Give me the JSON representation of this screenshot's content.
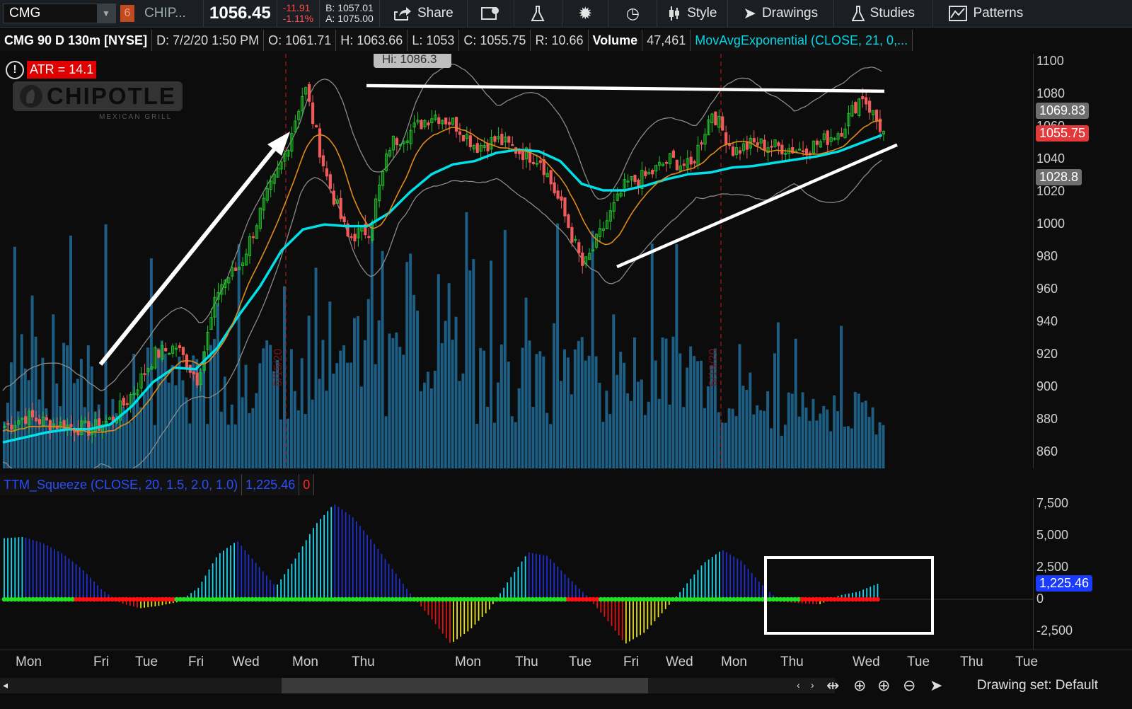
{
  "toolbar": {
    "symbol": "CMG",
    "link_badge": "6",
    "company": "CHIP...",
    "last": "1056.45",
    "net_change": "-11.91",
    "pct_change": "-1.11%",
    "bid": "B: 1057.01",
    "ask": "A: 1075.00",
    "share_label": "Share",
    "style_label": "Style",
    "drawings_label": "Drawings",
    "studies_label": "Studies",
    "patterns_label": "Patterns"
  },
  "infobar": {
    "title": "CMG 90 D 130m [NYSE]",
    "date": "D: 7/2/20 1:50 PM",
    "open": "O: 1061.71",
    "high": "H: 1063.66",
    "low": "L: 1053",
    "close": "C: 1055.75",
    "range": "R: 10.66",
    "volume_label": "Volume",
    "volume_value": "47,461",
    "study": "MovAvgExponential (CLOSE, 21, 0,..."
  },
  "atr_label": "ATR = 14.1",
  "logo": {
    "text": "CHIPOTLE",
    "sub": "MEXICAN GRILL"
  },
  "hi_label": "Hi: 1086.3",
  "price_axis": [
    "1100",
    "1080",
    "1060",
    "1040",
    "1020",
    "1000",
    "980",
    "960",
    "940",
    "920",
    "900",
    "880",
    "860"
  ],
  "price_tags": {
    "upper_band": "1069.83",
    "last": "1055.75",
    "ema": "1028.8"
  },
  "indicator": {
    "title": "TTM_Squeeze (CLOSE, 20, 1.5, 2.0, 1.0)",
    "value": "1,225.46",
    "signal": "0",
    "axis": [
      "7,500",
      "5,000",
      "2,500",
      "0",
      "-2,500"
    ],
    "tag": "1,225.46"
  },
  "x_axis": [
    "Mon",
    "Fri",
    "Tue",
    "Fri",
    "Wed",
    "Mon",
    "Thu",
    "Mon",
    "Thu",
    "Tue",
    "Fri",
    "Wed",
    "Mon",
    "Thu",
    "Wed",
    "Tue",
    "Thu",
    "Tue"
  ],
  "divider_dates": [
    "5/15/20",
    "6/19/20"
  ],
  "bottom": {
    "drawing_set": "Drawing set: Default"
  },
  "colors": {
    "up": "#22c02a",
    "down": "#f05a5a",
    "ema_fast": "#00e0e8",
    "ema_slow": "#e08a1a",
    "volume": "#1d5f84",
    "squeeze_on": "#ff1010",
    "squeeze_off": "#22e022"
  },
  "chart_data": [
    {
      "type": "line",
      "title": "CMG 90 D 130m [NYSE]",
      "xlabel": "",
      "ylabel": "",
      "ylim": [
        850,
        1105
      ],
      "grid": false,
      "series": [
        {
          "name": "MovAvgExponential",
          "values": [
            866,
            869,
            872,
            874,
            874,
            877,
            888,
            903,
            912,
            911,
            924,
            944,
            962,
            984,
            997,
            1000,
            999,
            999,
            1007,
            1020,
            1031,
            1037,
            1039,
            1044,
            1046,
            1045,
            1039,
            1025,
            1021,
            1021,
            1024,
            1028,
            1031,
            1032,
            1035,
            1036,
            1038,
            1040,
            1042,
            1045,
            1050,
            1055
          ]
        }
      ],
      "close_path": [
        876,
        882,
        878,
        876,
        874,
        880,
        897,
        920,
        925,
        905,
        962,
        975,
        1010,
        1040,
        1085,
        1030,
        992,
        997,
        1050,
        1058,
        1068,
        1062,
        1048,
        1052,
        1045,
        1040,
        1010,
        973,
        1000,
        1025,
        1030,
        1040,
        1035,
        1070,
        1045,
        1050,
        1048,
        1046,
        1050,
        1058,
        1080,
        1056
      ]
    },
    {
      "type": "bar",
      "title": "TTM_Squeeze (CLOSE, 20, 1.5, 2.0, 1.0)",
      "ylim": [
        -3500,
        7500
      ],
      "values": [
        4800,
        4900,
        4400,
        3600,
        2400,
        800,
        -300,
        -700,
        -500,
        -200,
        900,
        3500,
        4600,
        2800,
        1000,
        3200,
        5800,
        7500,
        6400,
        4500,
        2400,
        300,
        -1500,
        -3500,
        -2400,
        -800,
        1500,
        3700,
        3400,
        1800,
        300,
        -1500,
        -3500,
        -2600,
        -900,
        900,
        2800,
        3900,
        3000,
        1200,
        -200,
        -300,
        -400,
        300,
        600,
        1225
      ]
    }
  ]
}
